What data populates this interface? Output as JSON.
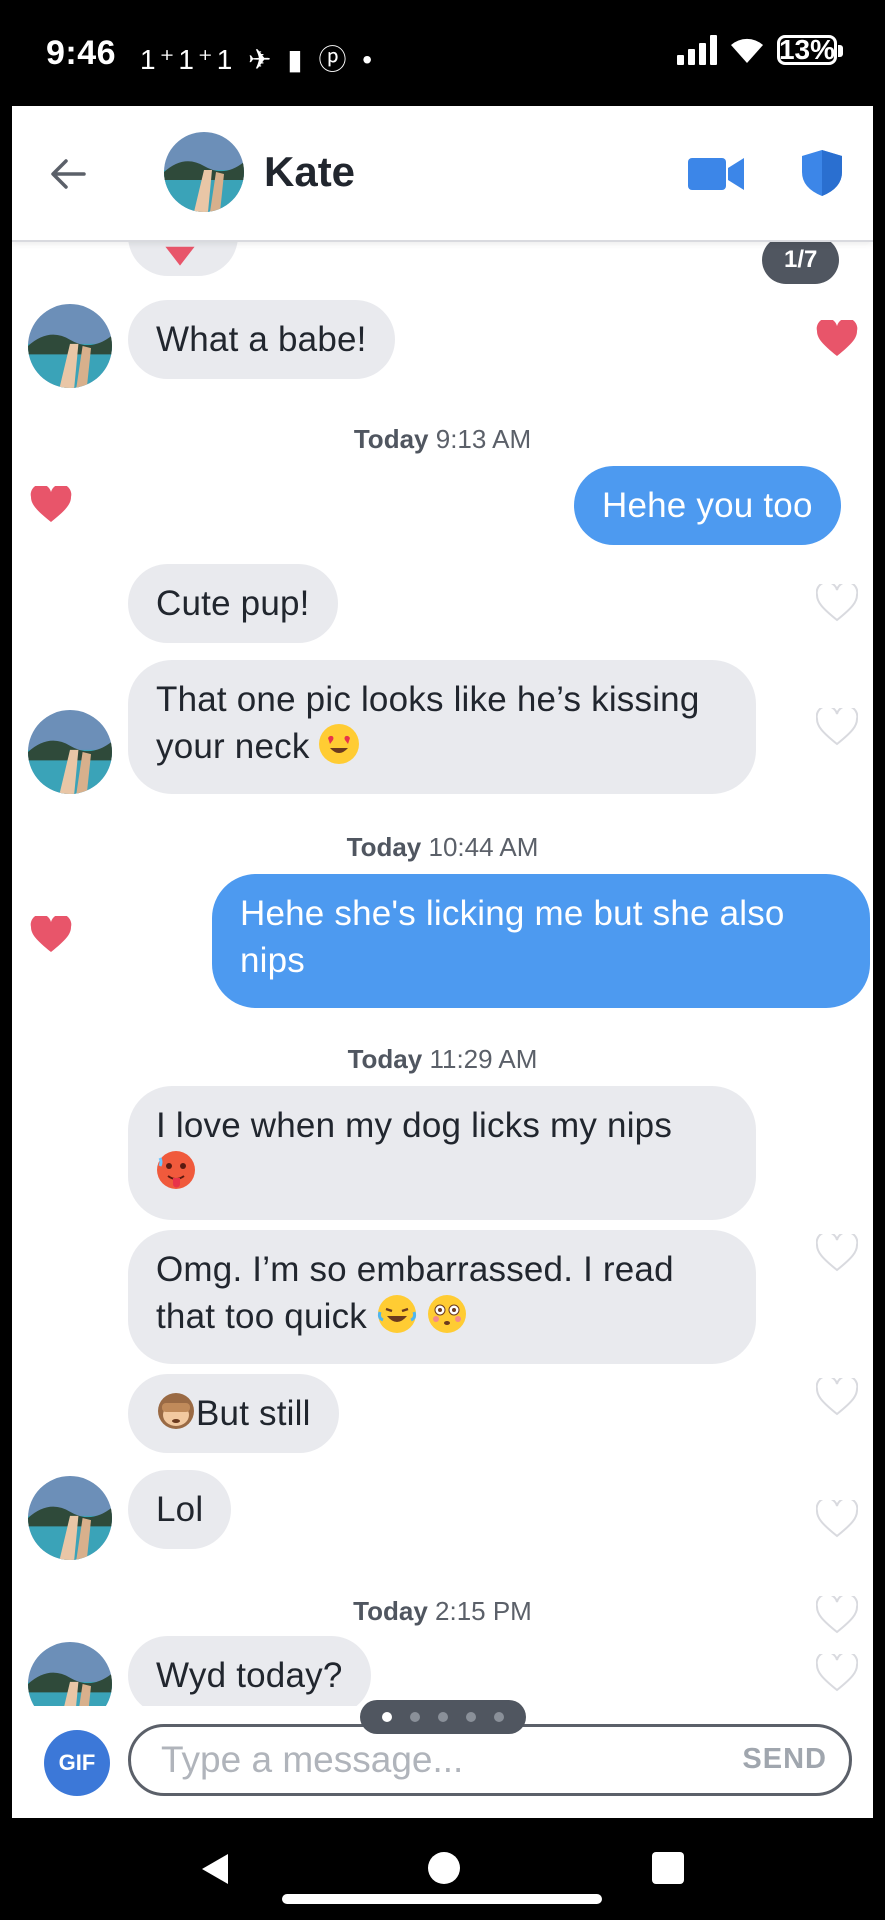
{
  "status_bar": {
    "time": "9:46",
    "notifications": "1⁺1⁺1 ✈ ▮ ⓟ •",
    "battery": "13%"
  },
  "header": {
    "contact_name": "Kate"
  },
  "photo_counter": "1/7",
  "messages": [
    {
      "text": "What a babe!"
    },
    {
      "timestamp_day": "Today",
      "timestamp_time": "9:13 AM"
    },
    {
      "text": "Hehe you too"
    },
    {
      "text": "Cute pup!"
    },
    {
      "text": "That one pic looks like he’s kissing your neck"
    },
    {
      "timestamp_day": "Today",
      "timestamp_time": "10:44 AM"
    },
    {
      "text_line1": "Hehe she's licking me but she also",
      "text_line2": "nips"
    },
    {
      "timestamp_day": "Today",
      "timestamp_time": "11:29 AM"
    },
    {
      "text": "I love when my dog licks my nips"
    },
    {
      "text_line1": "Omg. I’m so embarrassed. I read",
      "text_line2": "that too quick"
    },
    {
      "text": "But still"
    },
    {
      "text": "Lol"
    },
    {
      "timestamp_day": "Today",
      "timestamp_time": "2:15 PM"
    },
    {
      "text": "Wyd today?"
    }
  ],
  "composer": {
    "gif_label": "GIF",
    "placeholder": "Type a message...",
    "send_label": "SEND"
  },
  "colors": {
    "accent_blue": "#4d9af0",
    "bubble_gray": "#e9eaee",
    "heart_red": "#e8556a"
  }
}
